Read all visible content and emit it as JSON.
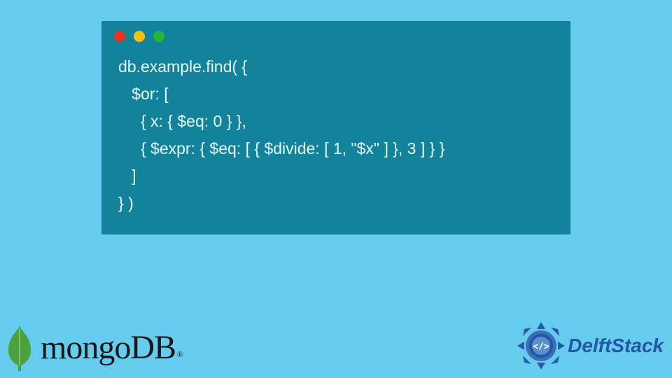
{
  "code": {
    "lines": [
      "db.example.find( {",
      "   $or: [",
      "     { x: { $eq: 0 } },",
      "     { $expr: { $eq: [ { $divide: [ 1, \"$x\" ] }, 3 ] } }",
      "   ]",
      "} )"
    ]
  },
  "window": {
    "dots": [
      "red",
      "yellow",
      "green"
    ]
  },
  "brands": {
    "mongo": "mongoDB",
    "mongo_reg": "®",
    "delft": "DelftStack"
  },
  "colors": {
    "bg": "#66CCEE",
    "window": "#13829B",
    "code_text": "#E6FBFF",
    "dot_red": "#EA3323",
    "dot_yellow": "#F6C10B",
    "dot_green": "#25B73B",
    "mongo_leaf": "#4BA13E",
    "delft_blue": "#2356A6"
  }
}
